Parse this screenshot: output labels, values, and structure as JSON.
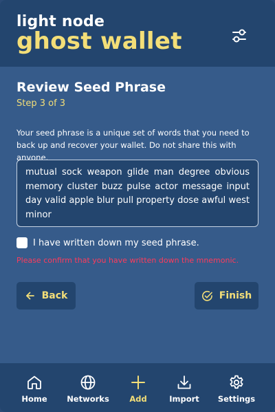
{
  "header": {
    "brand_top": "light node",
    "brand_main": "ghost wallet"
  },
  "review": {
    "title": "Review Seed Phrase",
    "step": "Step 3 of 3",
    "description": "Your seed phrase is a unique set of words that you need to back up and recover your wallet. Do not share this with anyone.",
    "seed_phrase": "mutual sock weapon glide man degree obvious memory cluster buzz pulse actor message input day valid apple blur pull property dose awful west minor",
    "confirm_label": "I have written down my seed phrase.",
    "confirm_checked": false,
    "error": "Please confirm that you have written down the mnemonic.",
    "back_label": "Back",
    "finish_label": "Finish"
  },
  "nav": {
    "items": [
      {
        "label": "Home",
        "icon": "home-icon"
      },
      {
        "label": "Networks",
        "icon": "globe-icon"
      },
      {
        "label": "Add",
        "icon": "plus-icon",
        "active": true
      },
      {
        "label": "Import",
        "icon": "download-icon"
      },
      {
        "label": "Settings",
        "icon": "gear-icon"
      }
    ]
  },
  "colors": {
    "page_background": "#365b8a",
    "header_background": "#23456e",
    "accent": "#f3de78",
    "error": "#ff3b5c"
  }
}
